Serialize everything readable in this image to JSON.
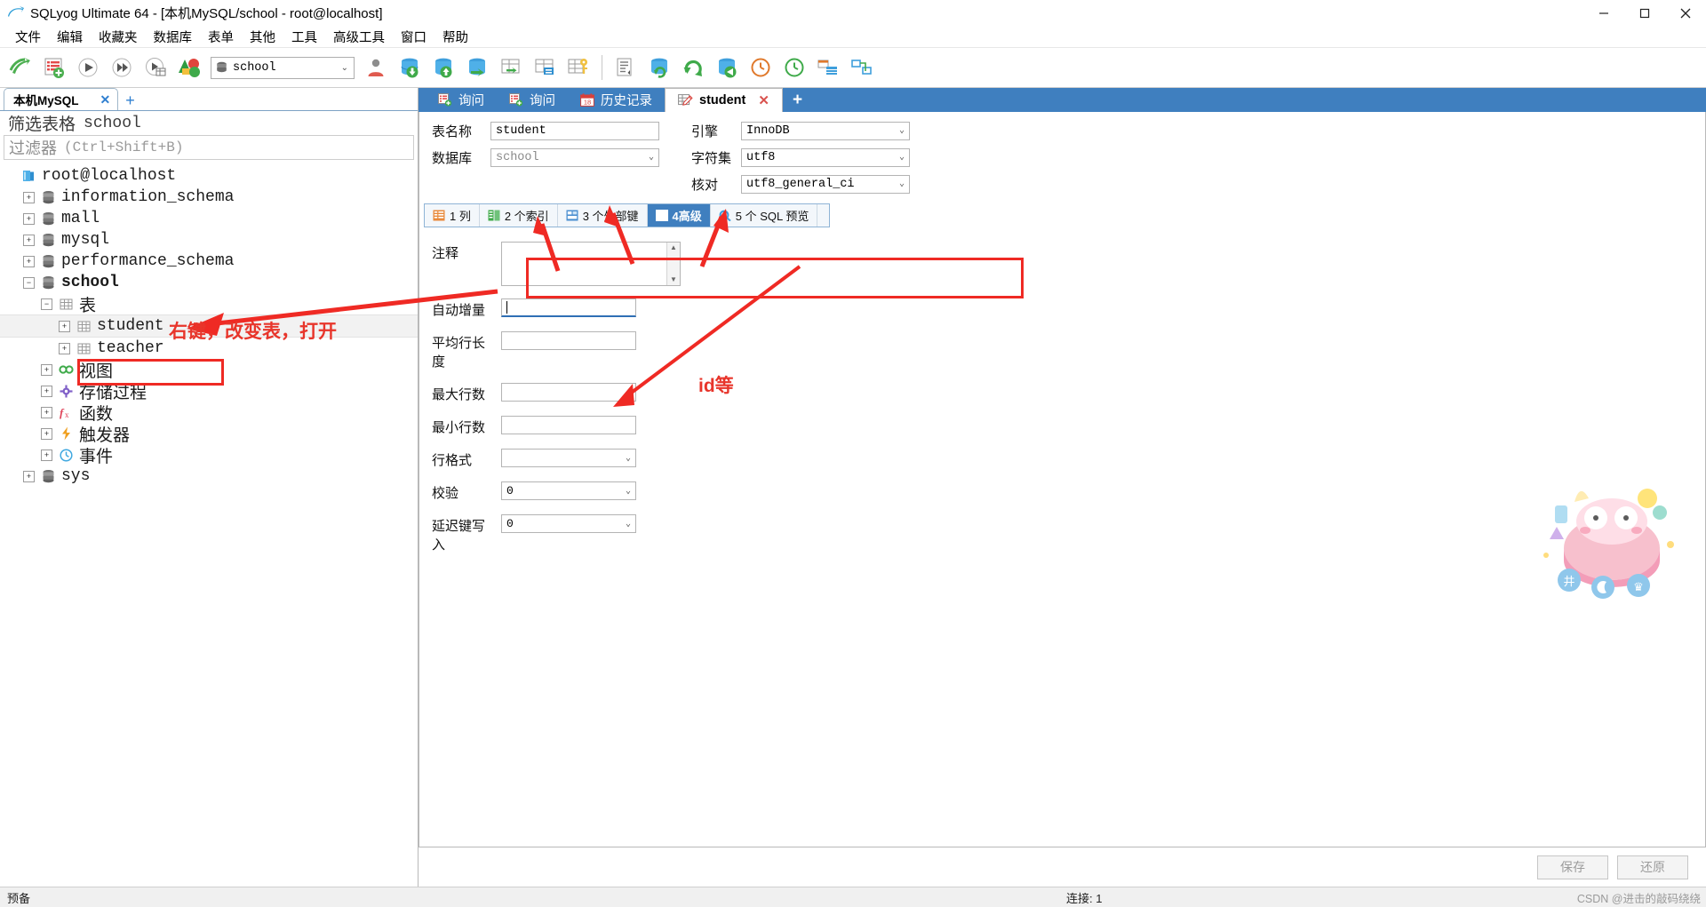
{
  "window": {
    "title": "SQLyog Ultimate 64 - [本机MySQL/school - root@localhost]",
    "minimize": "—",
    "maximize": "❐",
    "close": "✕"
  },
  "menu": {
    "items": [
      {
        "label": "文件"
      },
      {
        "label": "编辑"
      },
      {
        "label": "收藏夹"
      },
      {
        "label": "数据库"
      },
      {
        "label": "表单"
      },
      {
        "label": "其他"
      },
      {
        "label": "工具"
      },
      {
        "label": "高级工具"
      },
      {
        "label": "窗口"
      },
      {
        "label": "帮助"
      }
    ]
  },
  "toolbar": {
    "buttons": [
      {
        "name": "new-connection-icon"
      },
      {
        "name": "new-query-tab-icon"
      },
      {
        "name": "execute-query-icon"
      },
      {
        "name": "execute-all-queries-icon"
      },
      {
        "name": "execute-query-to-grid-icon"
      },
      {
        "name": "stop-execution-icon"
      }
    ],
    "db_select": {
      "value": "school",
      "icon": "database-icon",
      "chevron": "⌄"
    },
    "buttons2": [
      {
        "name": "user-manager-icon"
      },
      {
        "name": "backup-database-icon"
      },
      {
        "name": "restore-database-icon"
      },
      {
        "name": "import-external-data-icon"
      },
      {
        "name": "export-table-data-icon"
      },
      {
        "name": "schema-designer-icon"
      },
      {
        "name": "manage-index-icon"
      }
    ],
    "buttons3": [
      {
        "name": "sql-formatter-icon"
      },
      {
        "name": "sync-database-icon"
      },
      {
        "name": "refresh-objects-icon"
      },
      {
        "name": "copy-database-icon"
      },
      {
        "name": "scheduled-backup-icon"
      },
      {
        "name": "job-agent-icon"
      },
      {
        "name": "query-builder-icon"
      },
      {
        "name": "schema-sync-icon"
      }
    ]
  },
  "left_pane": {
    "connection_tab": {
      "label": "本机MySQL",
      "close": "✕",
      "add": "+"
    },
    "filter_header": {
      "title": "筛选表格",
      "db": "school"
    },
    "filter_input": {
      "label": "过滤器",
      "hint": "(Ctrl+Shift+B)"
    },
    "tree": [
      {
        "label": "root@localhost",
        "indent": 0,
        "expander": "",
        "icon": "connection-icon",
        "cjk": false,
        "bold": false,
        "selected": false
      },
      {
        "label": "information_schema",
        "indent": 1,
        "expander": "+",
        "icon": "database-icon",
        "cjk": false,
        "bold": false,
        "selected": false
      },
      {
        "label": "mall",
        "indent": 1,
        "expander": "+",
        "icon": "database-icon",
        "cjk": false,
        "bold": false,
        "selected": false
      },
      {
        "label": "mysql",
        "indent": 1,
        "expander": "+",
        "icon": "database-icon",
        "cjk": false,
        "bold": false,
        "selected": false
      },
      {
        "label": "performance_schema",
        "indent": 1,
        "expander": "+",
        "icon": "database-icon",
        "cjk": false,
        "bold": false,
        "selected": false
      },
      {
        "label": "school",
        "indent": 1,
        "expander": "−",
        "icon": "database-icon",
        "cjk": false,
        "bold": true,
        "selected": false
      },
      {
        "label": "表",
        "indent": 2,
        "expander": "−",
        "icon": "tables-folder-icon",
        "cjk": true,
        "bold": false,
        "selected": false
      },
      {
        "label": "student",
        "indent": 3,
        "expander": "+",
        "icon": "table-icon",
        "cjk": false,
        "bold": false,
        "selected": true
      },
      {
        "label": "teacher",
        "indent": 3,
        "expander": "+",
        "icon": "table-icon",
        "cjk": false,
        "bold": false,
        "selected": false
      },
      {
        "label": "视图",
        "indent": 2,
        "expander": "+",
        "icon": "views-icon",
        "cjk": true,
        "bold": false,
        "selected": false
      },
      {
        "label": "存储过程",
        "indent": 2,
        "expander": "+",
        "icon": "stored-procedures-icon",
        "cjk": true,
        "bold": false,
        "selected": false
      },
      {
        "label": "函数",
        "indent": 2,
        "expander": "+",
        "icon": "functions-icon",
        "cjk": true,
        "bold": false,
        "selected": false
      },
      {
        "label": "触发器",
        "indent": 2,
        "expander": "+",
        "icon": "triggers-icon",
        "cjk": true,
        "bold": false,
        "selected": false
      },
      {
        "label": "事件",
        "indent": 2,
        "expander": "+",
        "icon": "events-icon",
        "cjk": true,
        "bold": false,
        "selected": false
      },
      {
        "label": "sys",
        "indent": 1,
        "expander": "+",
        "icon": "database-icon",
        "cjk": false,
        "bold": false,
        "selected": false
      }
    ]
  },
  "object_tabs": [
    {
      "label": "询问",
      "icon": "query-icon",
      "active": false,
      "closable": false
    },
    {
      "label": "询问",
      "icon": "query-icon",
      "active": false,
      "closable": false
    },
    {
      "label": "历史记录",
      "icon": "history-icon",
      "active": false,
      "closable": false
    },
    {
      "label": "student",
      "icon": "table-edit-icon",
      "active": true,
      "closable": true,
      "close": "✕"
    }
  ],
  "object_tab_add": "+",
  "table_editor": {
    "fields": {
      "table_name": {
        "label": "表名称",
        "value": "student"
      },
      "database": {
        "label": "数据库",
        "value": "school",
        "chevron": "⌄"
      },
      "engine": {
        "label": "引擎",
        "value": "InnoDB",
        "chevron": "⌄"
      },
      "charset": {
        "label": "字符集",
        "value": "utf8",
        "chevron": "⌄"
      },
      "collation": {
        "label": "核对",
        "value": "utf8_general_ci",
        "chevron": "⌄"
      }
    },
    "sub_tabs": [
      {
        "label": "1 列",
        "icon": "columns-icon",
        "active": false
      },
      {
        "label": "2 个索引",
        "icon": "indexes-icon",
        "active": false
      },
      {
        "label": "3 个外部键",
        "icon": "foreign-keys-icon",
        "active": false
      },
      {
        "label": "4高级",
        "icon": "advanced-icon",
        "active": true
      },
      {
        "label": "5 个 SQL 预览",
        "icon": "sql-preview-icon",
        "active": false
      }
    ],
    "advanced": {
      "comment": {
        "label": "注释",
        "value": "",
        "scroll_up": "▲",
        "scroll_down": "▼"
      },
      "auto_increment": {
        "label": "自动增量",
        "value": ""
      },
      "avg_row_length": {
        "label": "平均行长度",
        "value": ""
      },
      "max_rows": {
        "label": "最大行数",
        "value": ""
      },
      "min_rows": {
        "label": "最小行数",
        "value": ""
      },
      "row_format": {
        "label": "行格式",
        "value": "",
        "chevron": "⌄"
      },
      "checksum": {
        "label": "校验",
        "value": "0",
        "chevron": "⌄"
      },
      "delay_key_write": {
        "label": "延迟键写入",
        "value": "0",
        "chevron": "⌄"
      }
    },
    "buttons": {
      "save": "保存",
      "restore": "还原"
    }
  },
  "statusbar": {
    "left": "预备",
    "connection": "连接: 1",
    "watermark": "CSDN @进击的敲码绕绕"
  },
  "annotations": {
    "right_click_note": "右键，改变表，打开",
    "id_note": "id等"
  },
  "colors": {
    "tab_active_blue": "#3f7fbf",
    "annotation_red": "#ef2a24",
    "accent_green": "#3faa4a",
    "db_blue": "#3f9fdc"
  }
}
